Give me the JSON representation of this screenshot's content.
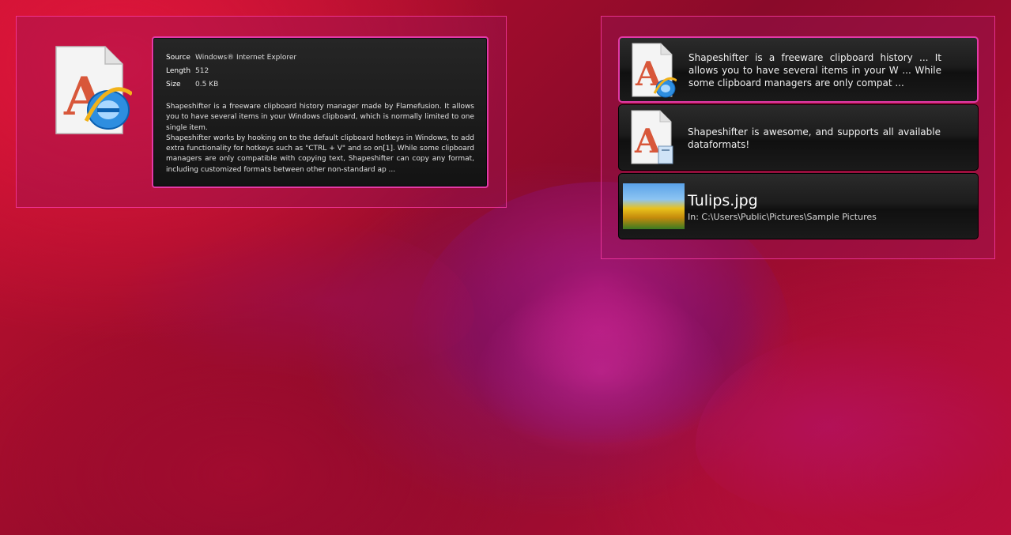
{
  "preview": {
    "icon": "internet-explorer-font-document-icon",
    "meta": [
      {
        "key": "Source",
        "value": "Windows® Internet Explorer"
      },
      {
        "key": "Length",
        "value": "512"
      },
      {
        "key": "Size",
        "value": "0.5 KB"
      }
    ],
    "paragraph1": "Shapeshifter is a freeware clipboard history manager made by Flamefusion. It allows you to have several items in your Windows clipboard, which is normally limited to one single item.",
    "paragraph2": "Shapeshifter works by hooking on to the default clipboard hotkeys in Windows, to add extra functionality for hotkeys such as \"CTRL + V\" and so on[1]. While some clipboard managers are only compatible with copying text, Shapeshifter can copy any format, including customized formats between other non-standard ap ..."
  },
  "history": {
    "items": [
      {
        "icon": "internet-explorer-font-document-icon",
        "text": "Shapeshifter is a freeware clipboard history ... It allows you to have several items in your W ... While some clipboard managers are only compat ..."
      },
      {
        "icon": "paste-font-document-icon",
        "text": "Shapeshifter is awesome, and supports all available dataformats!"
      },
      {
        "icon": "image-thumbnail",
        "title": "Tulips.jpg",
        "path": "In: C:\\Users\\Public\\Pictures\\Sample Pictures"
      }
    ]
  },
  "colors": {
    "accent": "#e33aa8",
    "panel_border": "#ff3caa",
    "card_dark": "#1c1c1c"
  }
}
